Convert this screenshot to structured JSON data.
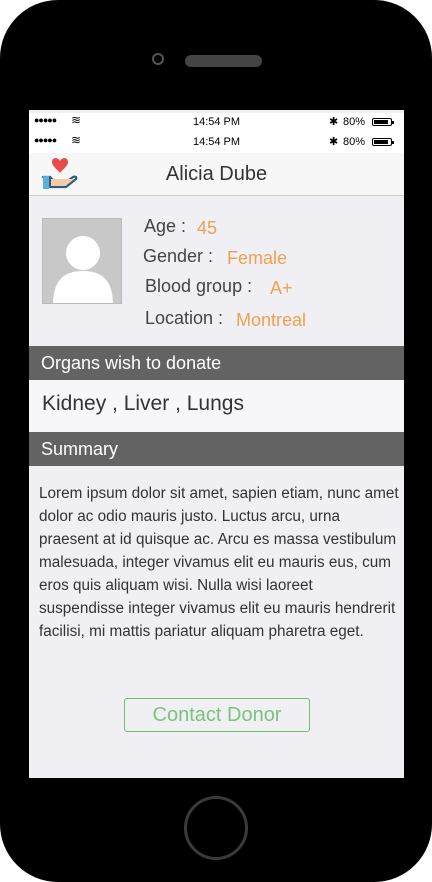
{
  "status_bar": {
    "signal": "●●●●●",
    "wifi": "≋",
    "time": "14:54 PM",
    "bluetooth": "✱",
    "battery_percent": "80%"
  },
  "nav": {
    "title": "Alicia Dube",
    "logo_icon": "heart-in-hand-icon"
  },
  "profile": {
    "age_label": "Age :",
    "age_value": "45",
    "gender_label": "Gender :",
    "gender_value": "Female",
    "blood_label": "Blood group :",
    "blood_value": "A+",
    "location_label": "Location :",
    "location_value": "Montreal"
  },
  "organs": {
    "header": "Organs wish to donate",
    "list": "Kidney , Liver , Lungs"
  },
  "summary": {
    "header": "Summary",
    "text": "Lorem ipsum dolor sit amet, sapien etiam, nunc amet dolor ac odio mauris justo. Luctus arcu, urna praesent at id quisque ac. Arcu es massa vestibulum malesuada, integer vivamus elit eu mauris eus, cum eros quis aliquam wisi. Nulla wisi laoreet suspendisse integer vivamus elit eu mauris hendrerit facilisi, mi mattis pariatur aliquam pharetra eget."
  },
  "actions": {
    "contact_label": "Contact Donor"
  },
  "colors": {
    "accent_orange": "#f0a050",
    "button_green": "#6cc36c",
    "section_bar": "#636363"
  }
}
